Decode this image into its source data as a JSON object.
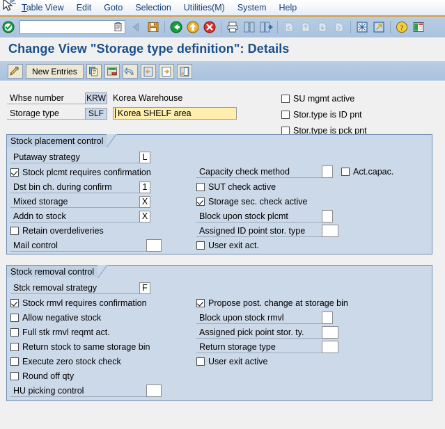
{
  "menu": {
    "items": [
      {
        "label": "Table View",
        "accel": "T"
      },
      {
        "label": "Edit",
        "accel": "E"
      },
      {
        "label": "Goto",
        "accel": "G"
      },
      {
        "label": "Selection",
        "accel": "S"
      },
      {
        "label": "Utilities(M)",
        "accel": "M"
      },
      {
        "label": "System",
        "accel": "y"
      },
      {
        "label": "Help",
        "accel": "H"
      }
    ]
  },
  "toolbar": {
    "command_value": "",
    "command_placeholder": "",
    "icons": [
      "enter-check-icon",
      "back-arrow-icon",
      "exit-up-icon",
      "cancel-icon",
      "print-icon",
      "find-icon",
      "find-next-icon",
      "first-page-icon",
      "previous-page-icon",
      "next-page-icon",
      "last-page-icon",
      "new-session-icon",
      "create-shortcut-icon",
      "help-icon",
      "layout-menu-icon"
    ]
  },
  "page": {
    "title": "Change View \"Storage type definition\": Details"
  },
  "apptoolbar": {
    "display_change_icon": "pencil-display-change-icon",
    "new_entries_label": "New Entries",
    "buttons": [
      "copy-as-icon",
      "delete-icon",
      "undo-icon",
      "previous-entry-icon",
      "next-entry-icon",
      "other-entry-icon"
    ]
  },
  "header": {
    "whse_number_label": "Whse number",
    "whse_number_value": "KRW",
    "whse_number_desc": "Korea Warehouse",
    "storage_type_label": "Storage type",
    "storage_type_value": "SLF",
    "storage_type_desc": "Korea SHELF area",
    "checkboxes": [
      {
        "label": "SU mgmt active",
        "checked": false,
        "name": "su-mgmt-active"
      },
      {
        "label": "Stor.type is ID pnt",
        "checked": false,
        "name": "stor-type-is-id-pnt"
      },
      {
        "label": "Stor.type is pck pnt",
        "checked": false,
        "name": "stor-type-is-pck-pnt"
      }
    ]
  },
  "stock_placement": {
    "title": "Stock placement control",
    "left": {
      "putaway_strategy_label": "Putaway strategy",
      "putaway_strategy_value": "L",
      "stock_plcmt_confirm_label": "Stock plcmt requires confirmation",
      "stock_plcmt_confirm_checked": true,
      "dst_bin_label": "Dst bin ch. during confirm",
      "dst_bin_value": "1",
      "mixed_storage_label": "Mixed storage",
      "mixed_storage_value": "X",
      "addn_to_stock_label": "Addn to stock",
      "addn_to_stock_value": "X",
      "retain_overdeliveries_label": "Retain overdeliveries",
      "retain_overdeliveries_checked": false,
      "mail_control_label": "Mail control",
      "mail_control_value": ""
    },
    "right": {
      "capacity_check_label": "Capacity check method",
      "capacity_check_value": "",
      "act_capac_label": "Act.capac.",
      "act_capac_checked": false,
      "sut_check_label": "SUT check active",
      "sut_check_checked": false,
      "storage_sec_label": "Storage sec. check active",
      "storage_sec_checked": true,
      "block_upon_plcmt_label": "Block upon stock plcmt",
      "block_upon_plcmt_value": "",
      "assigned_id_point_label": "Assigned ID point stor. type",
      "assigned_id_point_value": "",
      "user_exit_label": "User exit act.",
      "user_exit_checked": false
    }
  },
  "stock_removal": {
    "title": "Stock removal control",
    "left": {
      "strategy_label": "Stck removal strategy",
      "strategy_value": "F",
      "rmvl_confirm_label": "Stock rmvl requires confirmation",
      "rmvl_confirm_checked": true,
      "allow_negative_label": "Allow negative stock",
      "allow_negative_checked": false,
      "full_stk_label": "Full stk rmvl reqmt act.",
      "full_stk_checked": false,
      "return_same_bin_label": "Return stock to same storage bin",
      "return_same_bin_checked": false,
      "zero_stock_label": "Execute zero stock check",
      "zero_stock_checked": false,
      "round_off_label": "Round off qty",
      "round_off_checked": false,
      "hu_picking_label": "HU picking control",
      "hu_picking_value": ""
    },
    "right": {
      "propose_post_label": "Propose post. change at storage bin",
      "propose_post_checked": true,
      "block_upon_rmvl_label": "Block upon stock rmvl",
      "block_upon_rmvl_value": "",
      "assigned_pick_label": "Assigned pick point stor. ty.",
      "assigned_pick_value": "",
      "return_storage_type_label": "Return storage type",
      "return_storage_type_value": "",
      "user_exit_active_label": "User exit active",
      "user_exit_active_checked": false
    }
  },
  "colors": {
    "title_blue": "#1a4f8a",
    "panel_blue": "#ccd9e8",
    "toolbar_blue": "#a9c2de",
    "input_yellow": "#ffeeae",
    "accent_orange": "#d99b3b",
    "page_bg": "#f0f0f0"
  }
}
